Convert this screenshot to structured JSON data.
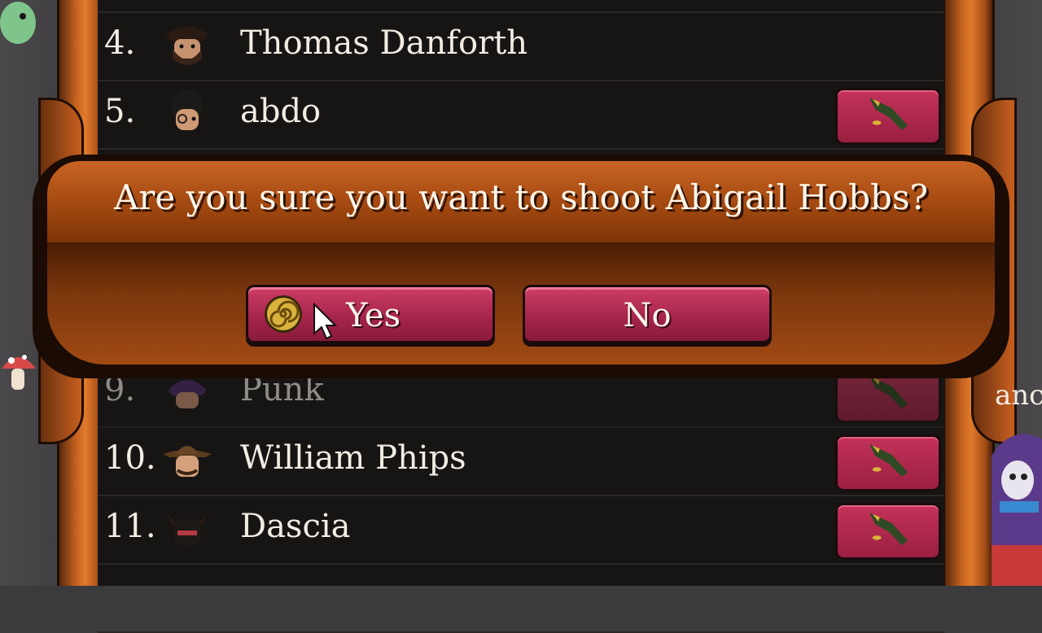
{
  "players": [
    {
      "num": "4.",
      "name": "Thomas Danforth",
      "has_gun": false,
      "avatar_icon": "bearded-hat-avatar-icon"
    },
    {
      "num": "5.",
      "name": "abdo",
      "has_gun": true,
      "avatar_icon": "curly-hair-avatar-icon"
    },
    {
      "num": "9.",
      "name": "Punk",
      "has_gun": true,
      "avatar_icon": "purple-hair-avatar-icon"
    },
    {
      "num": "10.",
      "name": "William Phips",
      "has_gun": true,
      "avatar_icon": "cowboy-avatar-icon"
    },
    {
      "num": "11.",
      "name": "Dascia",
      "has_gun": true,
      "avatar_icon": "horned-avatar-icon"
    }
  ],
  "dialog": {
    "title": "Are you sure you want to shoot Abigail Hobbs?",
    "yes_label": "Yes",
    "no_label": "No",
    "yes_icon": "spiral-coin-icon"
  },
  "side_text": "anc",
  "colors": {
    "button_red": "#a3234a",
    "wood_orange": "#c4621f",
    "panel_dark": "#171514"
  }
}
